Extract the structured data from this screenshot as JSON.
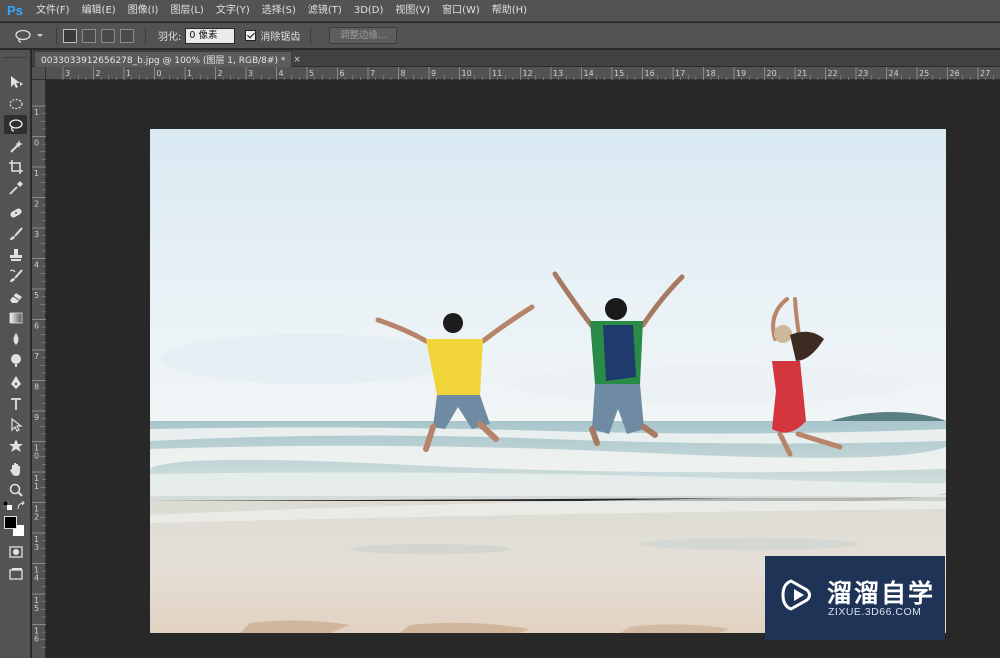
{
  "app": {
    "logo": "Ps"
  },
  "menu": [
    "文件(F)",
    "编辑(E)",
    "图像(I)",
    "图层(L)",
    "文字(Y)",
    "选择(S)",
    "滤镜(T)",
    "3D(D)",
    "视图(V)",
    "窗口(W)",
    "帮助(H)"
  ],
  "options": {
    "tool_icon": "lasso-icon",
    "feather_label": "羽化:",
    "feather_value": "0 像素",
    "antialias_label": "消除锯齿",
    "antialias_checked": true,
    "refine_edge_label": "调整边缘..."
  },
  "document": {
    "tab_title": "0033033912656278_b.jpg @ 100% (图层 1, RGB/8#) *",
    "close_glyph": "×"
  },
  "rulers": {
    "horizontal_labels": [
      "3",
      "2",
      "1",
      "0",
      "1",
      "2",
      "3",
      "4",
      "5",
      "6",
      "7",
      "8",
      "9",
      "10",
      "11",
      "12",
      "13",
      "14",
      "15",
      "16",
      "17",
      "18",
      "19",
      "20",
      "21",
      "22",
      "23",
      "24",
      "25",
      "26",
      "27"
    ],
    "vertical_labels": [
      "1",
      "0",
      "1",
      "2",
      "3",
      "4",
      "5",
      "6",
      "7",
      "8",
      "9",
      "10",
      "11",
      "12",
      "13",
      "14",
      "15",
      "16"
    ]
  },
  "tools": [
    "move-tool-icon",
    "marquee-tool-icon",
    "lasso-tool-icon",
    "magic-wand-tool-icon",
    "crop-tool-icon",
    "eyedropper-tool-icon",
    "spot-healing-tool-icon",
    "brush-tool-icon",
    "clone-stamp-tool-icon",
    "history-brush-tool-icon",
    "eraser-tool-icon",
    "gradient-tool-icon",
    "blur-tool-icon",
    "dodge-tool-icon",
    "pen-tool-icon",
    "type-tool-icon",
    "path-selection-tool-icon",
    "custom-shape-tool-icon",
    "hand-tool-icon",
    "zoom-tool-icon"
  ],
  "colors": {
    "foreground": "#000000",
    "background": "#ffffff",
    "accent": "#31a8ff",
    "watermark_bg": "#1e3355"
  },
  "watermark": {
    "title": "溜溜自学",
    "url": "ZIXUE.3D66.COM"
  }
}
